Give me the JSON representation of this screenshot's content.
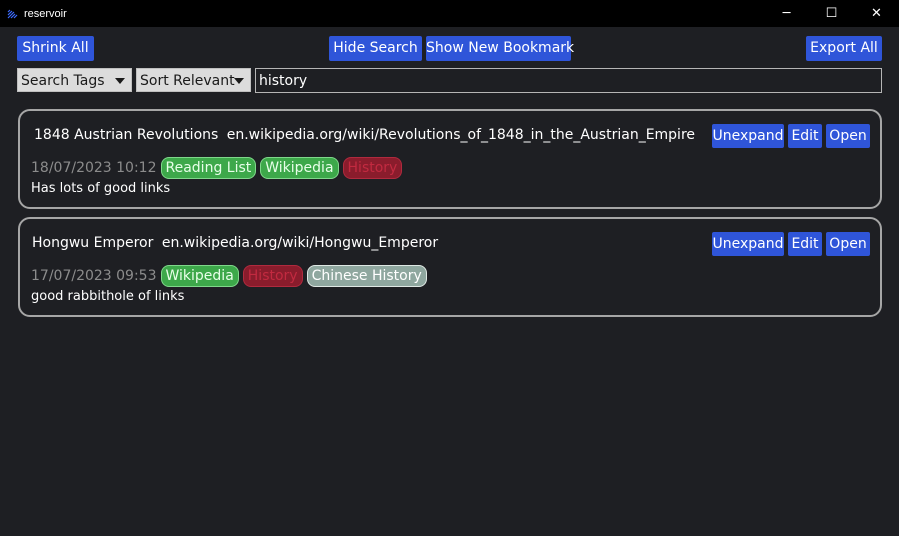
{
  "window": {
    "title": "reservoir",
    "minimize_glyph": "─",
    "maximize_glyph": "☐",
    "close_glyph": "✕"
  },
  "toolbar": {
    "shrink_all": "Shrink All",
    "hide_search": "Hide Search",
    "show_new_bookmark": "Show New Bookmark",
    "export_all": "Export All"
  },
  "search": {
    "tags_select": "Search Tags",
    "sort_select": "Sort Relevant",
    "query": "history"
  },
  "colors": {
    "accent": "#2f55d9",
    "background": "#1e1f23",
    "tag_reading_list": "#3da84a",
    "tag_wikipedia": "#3da84a",
    "tag_history": "#8a1c2c",
    "tag_chinese_history": "#8fa79f"
  },
  "bookmarks": [
    {
      "title": "1848 Austrian Revolutions",
      "url": "en.wikipedia.org/wiki/Revolutions_of_1848_in_the_Austrian_Empire",
      "date": "18/07/2023 10:12",
      "tags": [
        "Reading List",
        "Wikipedia",
        "History"
      ],
      "note": "Has lots of good links",
      "unexpand_label": "Unexpand",
      "edit_label": "Edit",
      "open_label": "Open"
    },
    {
      "title": "Hongwu Emperor",
      "url": "en.wikipedia.org/wiki/Hongwu_Emperor",
      "date": "17/07/2023 09:53",
      "tags": [
        "Wikipedia",
        "History",
        "Chinese History"
      ],
      "note": "good rabbithole of links",
      "unexpand_label": "Unexpand",
      "edit_label": "Edit",
      "open_label": "Open"
    }
  ]
}
